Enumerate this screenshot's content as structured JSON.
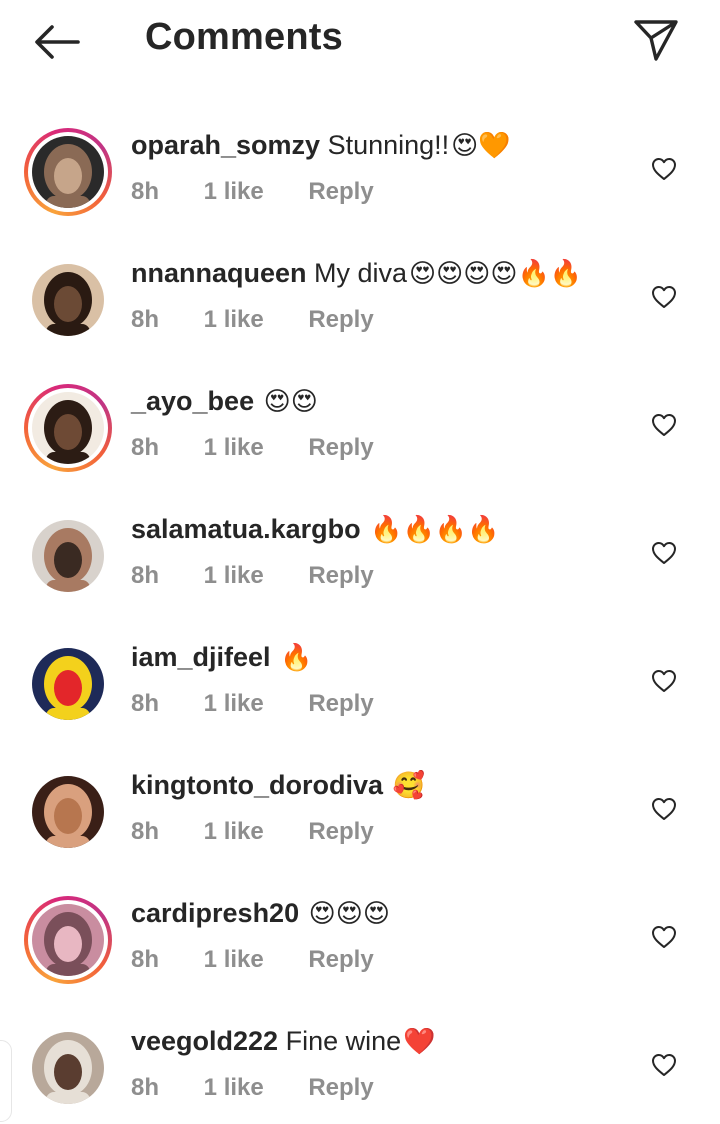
{
  "header": {
    "title": "Comments",
    "back_icon": "arrow-left-icon",
    "send_icon": "paper-plane-icon"
  },
  "comments": [
    {
      "username": "oparah_somzy",
      "text": " Stunning!!",
      "emojis": "😍🧡",
      "time": "8h",
      "likes": "1 like",
      "reply": "Reply",
      "story_ring": true,
      "avatar_colors": [
        "#2a2a2a",
        "#c6a58a",
        "#8a6a55"
      ]
    },
    {
      "username": "nnannaqueen",
      "text": " My diva",
      "emojis": "😍😍😍😍🔥🔥",
      "time": "8h",
      "likes": "1 like",
      "reply": "Reply",
      "story_ring": false,
      "avatar_colors": [
        "#d9c0a5",
        "#6b4a35",
        "#2a1a12"
      ]
    },
    {
      "username": "_ayo_bee",
      "text": " ",
      "emojis": "😍😍",
      "time": "8h",
      "likes": "1 like",
      "reply": "Reply",
      "story_ring": true,
      "avatar_colors": [
        "#f2ebe2",
        "#6e4a35",
        "#2c1c14"
      ]
    },
    {
      "username": "salamatua.kargbo",
      "text": " ",
      "emojis": "🔥🔥🔥🔥",
      "time": "8h",
      "likes": "1 like",
      "reply": "Reply",
      "story_ring": false,
      "avatar_colors": [
        "#d8d2cc",
        "#3a2a22",
        "#a87a62"
      ]
    },
    {
      "username": "iam_djifeel",
      "text": " ",
      "emojis": "🔥",
      "time": "8h",
      "likes": "1 like",
      "reply": "Reply",
      "story_ring": false,
      "avatar_colors": [
        "#1e2a58",
        "#e3262a",
        "#f3d11c"
      ]
    },
    {
      "username": "kingtonto_dorodiva",
      "text": " ",
      "emojis": "🥰",
      "time": "8h",
      "likes": "1 like",
      "reply": "Reply",
      "story_ring": false,
      "avatar_colors": [
        "#3a1f17",
        "#b7764f",
        "#d9a07e"
      ]
    },
    {
      "username": "cardipresh20",
      "text": " ",
      "emojis": "😍😍😍",
      "time": "8h",
      "likes": "1 like",
      "reply": "Reply",
      "story_ring": true,
      "avatar_colors": [
        "#c98da0",
        "#e8b7c2",
        "#7a4f5a"
      ]
    },
    {
      "username": "veegold222",
      "text": " Fine wine",
      "emojis": "❤️",
      "time": "8h",
      "likes": "1 like",
      "reply": "Reply",
      "story_ring": false,
      "avatar_colors": [
        "#b8a89a",
        "#5a3d30",
        "#e6dfd6"
      ]
    }
  ],
  "icons": {
    "like": "heart-outline-icon"
  },
  "colors": {
    "text": "#262626",
    "meta": "#8e8e8e",
    "story_ring": [
      "#f9a33b",
      "#c13584"
    ]
  }
}
